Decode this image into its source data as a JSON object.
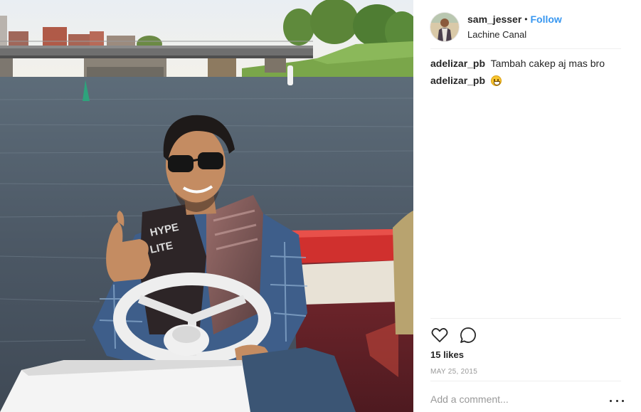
{
  "post": {
    "username": "sam_jesser",
    "separator": "•",
    "follow_label": "Follow",
    "location": "Lachine Canal"
  },
  "comments": [
    {
      "author": "adelizar_pb",
      "text": "Tambah cakep aj mas bro",
      "emoji": ""
    },
    {
      "author": "adelizar_pb",
      "text": "",
      "emoji": "grinning-face-emoji"
    }
  ],
  "actions": {
    "like_icon": "heart-icon",
    "comment_icon": "comment-icon",
    "more_icon": "more-options-icon"
  },
  "likes": "15 likes",
  "date": "MAY 25, 2015",
  "comment_input": {
    "placeholder": "Add a comment...",
    "value": ""
  },
  "colors": {
    "follow": "#3897f0",
    "text": "#262626",
    "muted": "#999999",
    "divider": "#efefef"
  },
  "photo": {
    "description_icon": "post-photo"
  }
}
